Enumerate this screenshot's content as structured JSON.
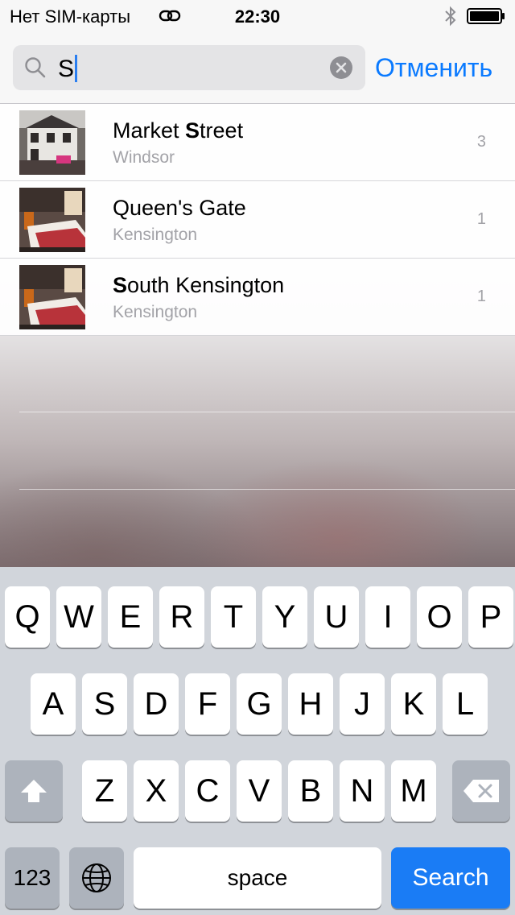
{
  "status_bar": {
    "carrier": "Нет SIM-карты",
    "time": "22:30"
  },
  "search": {
    "query": "S",
    "cancel_label": "Отменить"
  },
  "results": [
    {
      "title_before": "Market ",
      "title_match": "S",
      "title_after": "treet",
      "subtitle": "Windsor",
      "count": "3",
      "thumb": "building"
    },
    {
      "title_before": "Queen's Gate",
      "title_match": "",
      "title_after": "",
      "subtitle": "Kensington",
      "count": "1",
      "thumb": "bedroom"
    },
    {
      "title_before": "",
      "title_match": "S",
      "title_after": "outh Kensington",
      "subtitle": "Kensington",
      "count": "1",
      "thumb": "bedroom"
    }
  ],
  "keyboard": {
    "row1": [
      "Q",
      "W",
      "E",
      "R",
      "T",
      "Y",
      "U",
      "I",
      "O",
      "P"
    ],
    "row2": [
      "A",
      "S",
      "D",
      "F",
      "G",
      "H",
      "J",
      "K",
      "L"
    ],
    "row3": [
      "Z",
      "X",
      "C",
      "V",
      "B",
      "N",
      "M"
    ],
    "numbers_label": "123",
    "space_label": "space",
    "search_label": "Search"
  },
  "colors": {
    "accent": "#0a7aff",
    "search_key": "#1a7cf5",
    "keyboard_bg": "#d1d5db"
  }
}
